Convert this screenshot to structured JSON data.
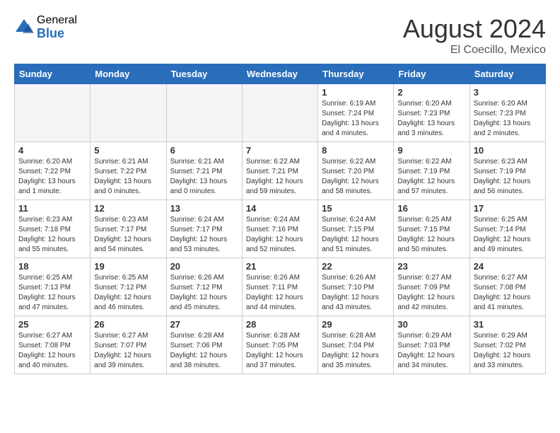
{
  "header": {
    "logo_general": "General",
    "logo_blue": "Blue",
    "month_title": "August 2024",
    "location": "El Coecillo, Mexico"
  },
  "weekdays": [
    "Sunday",
    "Monday",
    "Tuesday",
    "Wednesday",
    "Thursday",
    "Friday",
    "Saturday"
  ],
  "weeks": [
    [
      {
        "day": "",
        "info": ""
      },
      {
        "day": "",
        "info": ""
      },
      {
        "day": "",
        "info": ""
      },
      {
        "day": "",
        "info": ""
      },
      {
        "day": "1",
        "info": "Sunrise: 6:19 AM\nSunset: 7:24 PM\nDaylight: 13 hours\nand 4 minutes."
      },
      {
        "day": "2",
        "info": "Sunrise: 6:20 AM\nSunset: 7:23 PM\nDaylight: 13 hours\nand 3 minutes."
      },
      {
        "day": "3",
        "info": "Sunrise: 6:20 AM\nSunset: 7:23 PM\nDaylight: 13 hours\nand 2 minutes."
      }
    ],
    [
      {
        "day": "4",
        "info": "Sunrise: 6:20 AM\nSunset: 7:22 PM\nDaylight: 13 hours\nand 1 minute."
      },
      {
        "day": "5",
        "info": "Sunrise: 6:21 AM\nSunset: 7:22 PM\nDaylight: 13 hours\nand 0 minutes."
      },
      {
        "day": "6",
        "info": "Sunrise: 6:21 AM\nSunset: 7:21 PM\nDaylight: 13 hours\nand 0 minutes."
      },
      {
        "day": "7",
        "info": "Sunrise: 6:22 AM\nSunset: 7:21 PM\nDaylight: 12 hours\nand 59 minutes."
      },
      {
        "day": "8",
        "info": "Sunrise: 6:22 AM\nSunset: 7:20 PM\nDaylight: 12 hours\nand 58 minutes."
      },
      {
        "day": "9",
        "info": "Sunrise: 6:22 AM\nSunset: 7:19 PM\nDaylight: 12 hours\nand 57 minutes."
      },
      {
        "day": "10",
        "info": "Sunrise: 6:23 AM\nSunset: 7:19 PM\nDaylight: 12 hours\nand 56 minutes."
      }
    ],
    [
      {
        "day": "11",
        "info": "Sunrise: 6:23 AM\nSunset: 7:18 PM\nDaylight: 12 hours\nand 55 minutes."
      },
      {
        "day": "12",
        "info": "Sunrise: 6:23 AM\nSunset: 7:17 PM\nDaylight: 12 hours\nand 54 minutes."
      },
      {
        "day": "13",
        "info": "Sunrise: 6:24 AM\nSunset: 7:17 PM\nDaylight: 12 hours\nand 53 minutes."
      },
      {
        "day": "14",
        "info": "Sunrise: 6:24 AM\nSunset: 7:16 PM\nDaylight: 12 hours\nand 52 minutes."
      },
      {
        "day": "15",
        "info": "Sunrise: 6:24 AM\nSunset: 7:15 PM\nDaylight: 12 hours\nand 51 minutes."
      },
      {
        "day": "16",
        "info": "Sunrise: 6:25 AM\nSunset: 7:15 PM\nDaylight: 12 hours\nand 50 minutes."
      },
      {
        "day": "17",
        "info": "Sunrise: 6:25 AM\nSunset: 7:14 PM\nDaylight: 12 hours\nand 49 minutes."
      }
    ],
    [
      {
        "day": "18",
        "info": "Sunrise: 6:25 AM\nSunset: 7:13 PM\nDaylight: 12 hours\nand 47 minutes."
      },
      {
        "day": "19",
        "info": "Sunrise: 6:25 AM\nSunset: 7:12 PM\nDaylight: 12 hours\nand 46 minutes."
      },
      {
        "day": "20",
        "info": "Sunrise: 6:26 AM\nSunset: 7:12 PM\nDaylight: 12 hours\nand 45 minutes."
      },
      {
        "day": "21",
        "info": "Sunrise: 6:26 AM\nSunset: 7:11 PM\nDaylight: 12 hours\nand 44 minutes."
      },
      {
        "day": "22",
        "info": "Sunrise: 6:26 AM\nSunset: 7:10 PM\nDaylight: 12 hours\nand 43 minutes."
      },
      {
        "day": "23",
        "info": "Sunrise: 6:27 AM\nSunset: 7:09 PM\nDaylight: 12 hours\nand 42 minutes."
      },
      {
        "day": "24",
        "info": "Sunrise: 6:27 AM\nSunset: 7:08 PM\nDaylight: 12 hours\nand 41 minutes."
      }
    ],
    [
      {
        "day": "25",
        "info": "Sunrise: 6:27 AM\nSunset: 7:08 PM\nDaylight: 12 hours\nand 40 minutes."
      },
      {
        "day": "26",
        "info": "Sunrise: 6:27 AM\nSunset: 7:07 PM\nDaylight: 12 hours\nand 39 minutes."
      },
      {
        "day": "27",
        "info": "Sunrise: 6:28 AM\nSunset: 7:06 PM\nDaylight: 12 hours\nand 38 minutes."
      },
      {
        "day": "28",
        "info": "Sunrise: 6:28 AM\nSunset: 7:05 PM\nDaylight: 12 hours\nand 37 minutes."
      },
      {
        "day": "29",
        "info": "Sunrise: 6:28 AM\nSunset: 7:04 PM\nDaylight: 12 hours\nand 35 minutes."
      },
      {
        "day": "30",
        "info": "Sunrise: 6:29 AM\nSunset: 7:03 PM\nDaylight: 12 hours\nand 34 minutes."
      },
      {
        "day": "31",
        "info": "Sunrise: 6:29 AM\nSunset: 7:02 PM\nDaylight: 12 hours\nand 33 minutes."
      }
    ]
  ]
}
